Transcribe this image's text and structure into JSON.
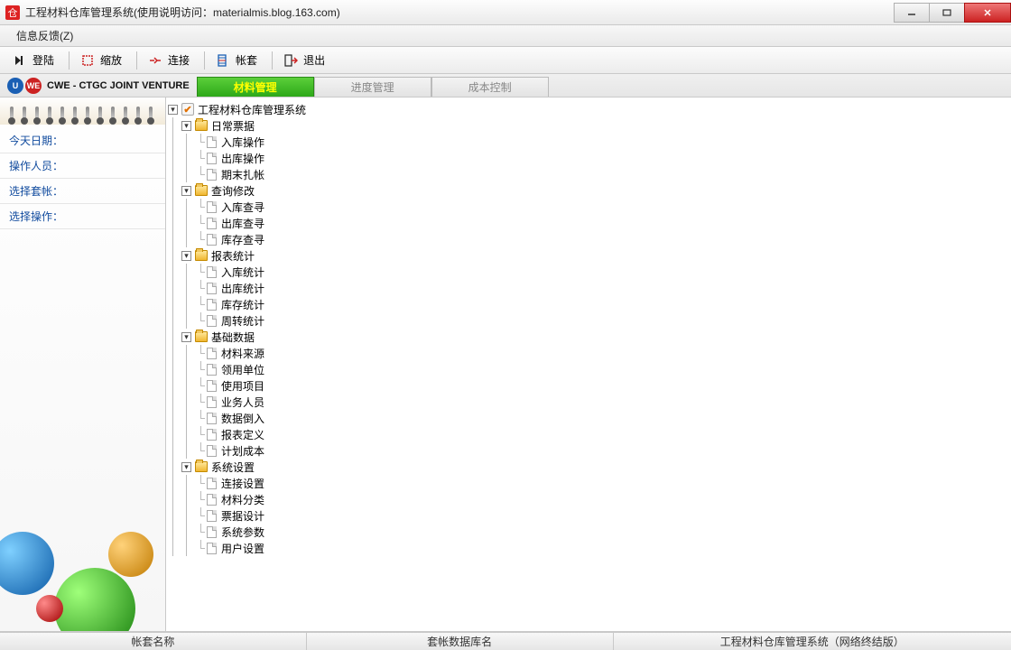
{
  "window": {
    "title": "工程材料仓库管理系统(使用说明访问：materialmis.blog.163.com)"
  },
  "menubar": {
    "feedback": "信息反馈(Z)"
  },
  "toolbar": {
    "login": "登陆",
    "zoom": "缩放",
    "connect": "连接",
    "accounts": "帐套",
    "exit": "退出"
  },
  "logo_text": "CWE - CTGC JOINT VENTURE",
  "tabs": {
    "materials": "材料管理",
    "progress": "进度管理",
    "cost": "成本控制"
  },
  "sidebar": {
    "today_label": "今天日期：",
    "operator_label": "操作人员：",
    "account_label": "选择套帐：",
    "operation_label": "选择操作："
  },
  "tree": {
    "root": "工程材料仓库管理系统",
    "groups": [
      {
        "name": "日常票据",
        "items": [
          "入库操作",
          "出库操作",
          "期末扎帐"
        ]
      },
      {
        "name": "查询修改",
        "items": [
          "入库查寻",
          "出库查寻",
          "库存查寻"
        ]
      },
      {
        "name": "报表统计",
        "items": [
          "入库统计",
          "出库统计",
          "库存统计",
          "周转统计"
        ]
      },
      {
        "name": "基础数据",
        "items": [
          "材料来源",
          "领用单位",
          "使用项目",
          "业务人员",
          "数据倒入",
          "报表定义",
          "计划成本"
        ]
      },
      {
        "name": "系统设置",
        "items": [
          "连接设置",
          "材料分类",
          "票据设计",
          "系统参数",
          "用户设置"
        ]
      }
    ]
  },
  "statusbar": {
    "account_name": "帐套名称",
    "db_name": "套帐数据库名",
    "app_edition": "工程材料仓库管理系统（网络终结版）"
  }
}
